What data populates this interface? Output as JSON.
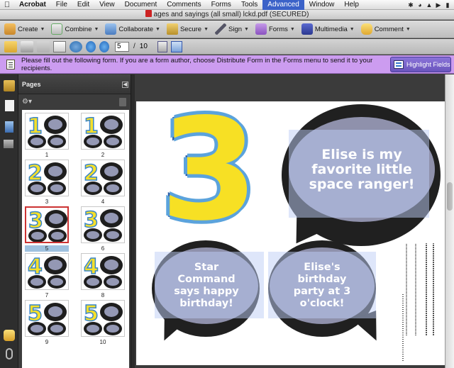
{
  "menubar": {
    "app_name": "Acrobat",
    "items": [
      "File",
      "Edit",
      "View",
      "Document",
      "Comments",
      "Forms",
      "Tools",
      "Advanced",
      "Window",
      "Help"
    ],
    "active_item": "Advanced"
  },
  "window": {
    "title": "ages and sayings (all small) lckd.pdf (SECURED)"
  },
  "tasks_toolbar": {
    "create": "Create",
    "combine": "Combine",
    "collaborate": "Collaborate",
    "secure": "Secure",
    "sign": "Sign",
    "forms": "Forms",
    "multimedia": "Multimedia",
    "comment": "Comment"
  },
  "nav_toolbar": {
    "current_page": "5",
    "separator": "/",
    "total_pages": "10"
  },
  "form_bar": {
    "message": "Please fill out the following form. If you are a form author, choose Distribute Form in the Forms menu to send it to your recipients.",
    "highlight_button": "Highlight Fields"
  },
  "pages_panel": {
    "title": "Pages",
    "thumbnails": [
      {
        "label": "1",
        "digit": "1"
      },
      {
        "label": "2",
        "digit": "1"
      },
      {
        "label": "3",
        "digit": "2"
      },
      {
        "label": "4",
        "digit": "2"
      },
      {
        "label": "5",
        "digit": "3"
      },
      {
        "label": "6",
        "digit": "3"
      },
      {
        "label": "7",
        "digit": "4"
      },
      {
        "label": "8",
        "digit": "4"
      },
      {
        "label": "9",
        "digit": "5"
      },
      {
        "label": "10",
        "digit": "5"
      }
    ],
    "selected_index": 4
  },
  "document": {
    "big_number": "3",
    "bubble_main": "Elise is my favorite little space ranger!",
    "bubble_left": "Star Command says happy birthday!",
    "bubble_right": "Elise's birthday party at 3 o'clock!"
  },
  "colors": {
    "form_bar": "#cc9cf0",
    "number_fill": "#f7e024",
    "number_outline": "#5ba3dc",
    "bubble": "#202020",
    "bubble_fill": "#8f91ac"
  }
}
